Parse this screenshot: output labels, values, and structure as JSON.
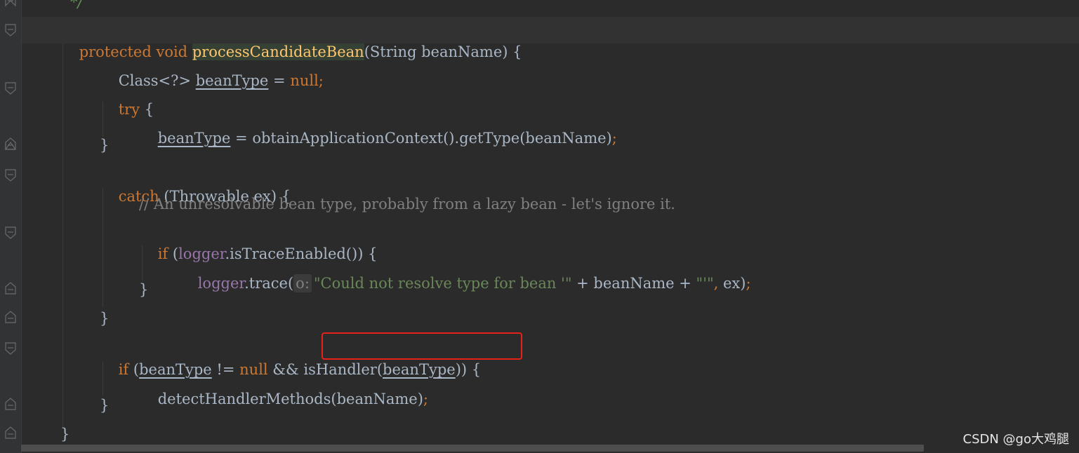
{
  "editor": {
    "comment_end": "*/",
    "lines": {
      "l1": {
        "kw_protected": "protected",
        "kw_void": "void",
        "method": "processCandidateBean",
        "params": "(String beanName) {"
      },
      "l2": {
        "type": "Class<?> ",
        "var": "beanType",
        "eq": " = ",
        "null": "null",
        "semi": ";"
      },
      "l3": {
        "kw": "try",
        "rest": " {"
      },
      "l4": {
        "var": "beanType",
        "rest": " = obtainApplicationContext().getType(beanName)",
        "semi": ";"
      },
      "l5": {
        "text": "}"
      },
      "l6": {
        "kw": "catch",
        "rest": " (Throwable ex) {"
      },
      "l7": {
        "comment": "// An unresolvable bean type, probably from a lazy bean - let's ignore it."
      },
      "l8": {
        "kw": "if",
        "open": " (",
        "field": "logger",
        "rest": ".isTraceEnabled()) {"
      },
      "l9": {
        "field": "logger",
        "call": ".trace(",
        "hint": "o:",
        "str1": "\"Could not resolve type for bean '\"",
        "plus1": " + beanName + ",
        "str2": "\"'\"",
        "comma": ",",
        "ex": " ex)",
        "semi": ";"
      },
      "l10": {
        "text": "}"
      },
      "l11": {
        "text": "}"
      },
      "l12": {
        "kw": "if",
        "open": " (",
        "var1": "beanType",
        "neq": " != ",
        "null": "null",
        "and": " && isHandler(",
        "var2": "beanType",
        "close": ")) {"
      },
      "l13": {
        "call": "detectHandlerMethods(beanName)",
        "semi": ";"
      },
      "l14": {
        "text": "}"
      },
      "l15": {
        "text": "}"
      }
    }
  },
  "watermark": "CSDN @go大鸡腿",
  "colors": {
    "background": "#2b2b2b",
    "keyword": "#cc7832",
    "method_decl": "#ffc66d",
    "string": "#6a8759",
    "field": "#9876aa",
    "comment": "#808080",
    "highlight_box": "#e8201c"
  }
}
